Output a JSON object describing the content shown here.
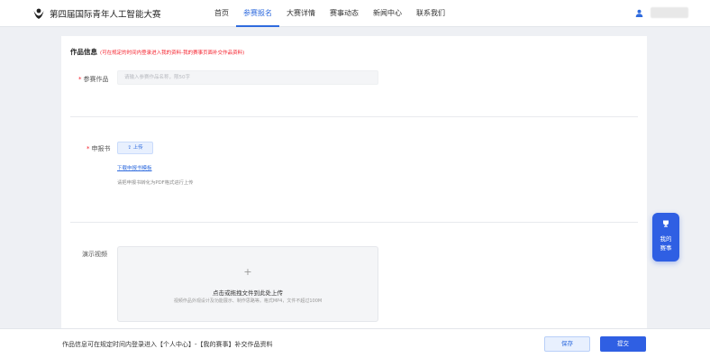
{
  "header": {
    "brand": "第四届国际青年人工智能大赛",
    "nav": [
      {
        "label": "首页"
      },
      {
        "label": "参赛报名"
      },
      {
        "label": "大赛详情"
      },
      {
        "label": "赛事动态"
      },
      {
        "label": "新闻中心"
      },
      {
        "label": "联系我们"
      }
    ],
    "active_nav": "参赛报名"
  },
  "form": {
    "section_title": "作品信息",
    "section_hint": "(可在规定的时间内登录进入我的资料-我的赛事页面补交作品资料)",
    "work": {
      "label": "参赛作品",
      "placeholder": "请输入参赛作品名称，限50字",
      "value": ""
    },
    "report": {
      "label": "申报书",
      "upload_label": "⇪ 上传",
      "template_link": "下载申报书模板",
      "tip": "请把申报书转化为PDF格式进行上传"
    },
    "video": {
      "label": "演示视频",
      "plus": "+",
      "drop_text": "点击或拖拽文件到此处上传",
      "drop_subtext": "视频作品外观设计及功能展示、制作思路等。格式MP4，文件不超过100M"
    }
  },
  "float_widget": {
    "label": "我的赛事"
  },
  "footer": {
    "note": "作品信息可在规定时间内登录进入【个人中心】-【我的赛事】补交作品资料",
    "save_label": "保存",
    "submit_label": "提交"
  },
  "colors": {
    "primary": "#2f5fe3",
    "link": "#2f6bde",
    "required": "#f5222d",
    "background": "#eef0f4"
  }
}
